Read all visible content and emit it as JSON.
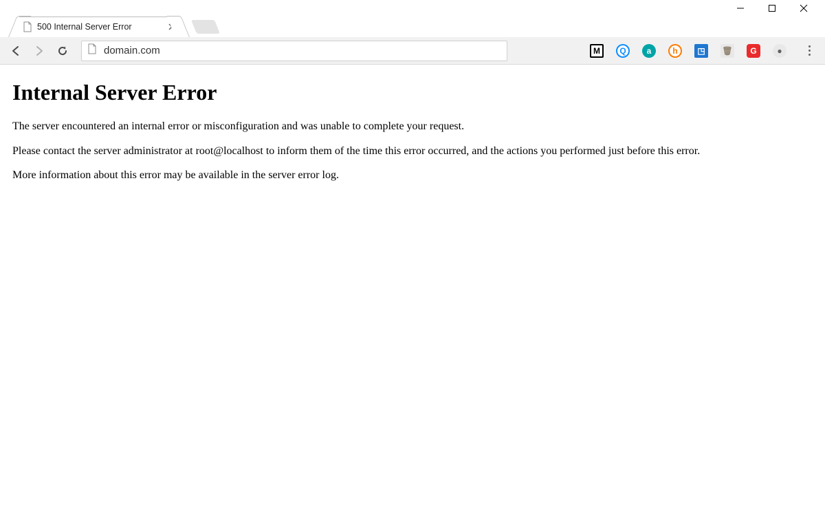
{
  "window": {
    "tab_title": "500 Internal Server Error"
  },
  "toolbar": {
    "url": "domain.com"
  },
  "extensions": [
    {
      "name": "ext-m",
      "bg": "#ffffff",
      "fg": "#000000",
      "letter": "M",
      "border": "#000000"
    },
    {
      "name": "ext-q-blue",
      "bg": "#ffffff",
      "fg": "#0b8dff",
      "letter": "Q",
      "border": "#0b8dff",
      "round": true
    },
    {
      "name": "ext-a-teal",
      "bg": "#00a4a6",
      "fg": "#ffffff",
      "letter": "a",
      "round": true
    },
    {
      "name": "ext-h-orange",
      "bg": "#ffffff",
      "fg": "#ff7a00",
      "letter": "h",
      "border": "#ff7a00",
      "round": true
    },
    {
      "name": "ext-screenshot",
      "bg": "#1f77d0",
      "fg": "#ffffff",
      "letter": "◳"
    },
    {
      "name": "ext-trash",
      "bg": "#e8e8e8",
      "fg": "#8f826f",
      "letter": "🗑"
    },
    {
      "name": "ext-g-red",
      "bg": "#ea2b2b",
      "fg": "#ffffff",
      "letter": "G",
      "roundsq": true
    },
    {
      "name": "ext-rec",
      "bg": "#e8e8e8",
      "fg": "#5f6062",
      "letter": "●",
      "round": true
    }
  ],
  "page": {
    "heading": "Internal Server Error",
    "p1": "The server encountered an internal error or misconfiguration and was unable to complete your request.",
    "p2": "Please contact the server administrator at root@localhost to inform them of the time this error occurred, and the actions you performed just before this error.",
    "p3": "More information about this error may be available in the server error log."
  }
}
